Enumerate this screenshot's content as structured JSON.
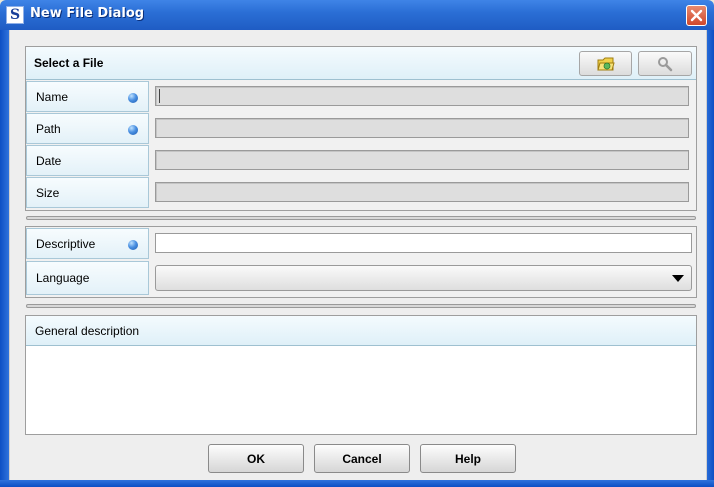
{
  "window": {
    "title": "New File Dialog",
    "app_icon_letter": "S"
  },
  "file_section": {
    "header": "Select a File",
    "buttons": [
      {
        "name": "open-folder-button",
        "icon": "folder-icon"
      },
      {
        "name": "search-button",
        "icon": "magnifier-icon"
      }
    ],
    "fields": [
      {
        "label": "Name",
        "required": true,
        "value": ""
      },
      {
        "label": "Path",
        "required": true,
        "value": ""
      },
      {
        "label": "Date",
        "required": false,
        "value": ""
      },
      {
        "label": "Size",
        "required": false,
        "value": ""
      }
    ]
  },
  "meta_section": {
    "descriptive": {
      "label": "Descriptive",
      "required": true,
      "value": ""
    },
    "language": {
      "label": "Language",
      "value": ""
    }
  },
  "description_section": {
    "header": "General description",
    "value": ""
  },
  "actions": {
    "ok": "OK",
    "cancel": "Cancel",
    "help": "Help"
  },
  "colors": {
    "titlebar": "#2b6fd6",
    "header_bg": "#dff0f8",
    "required_dot": "#4a90e2"
  }
}
